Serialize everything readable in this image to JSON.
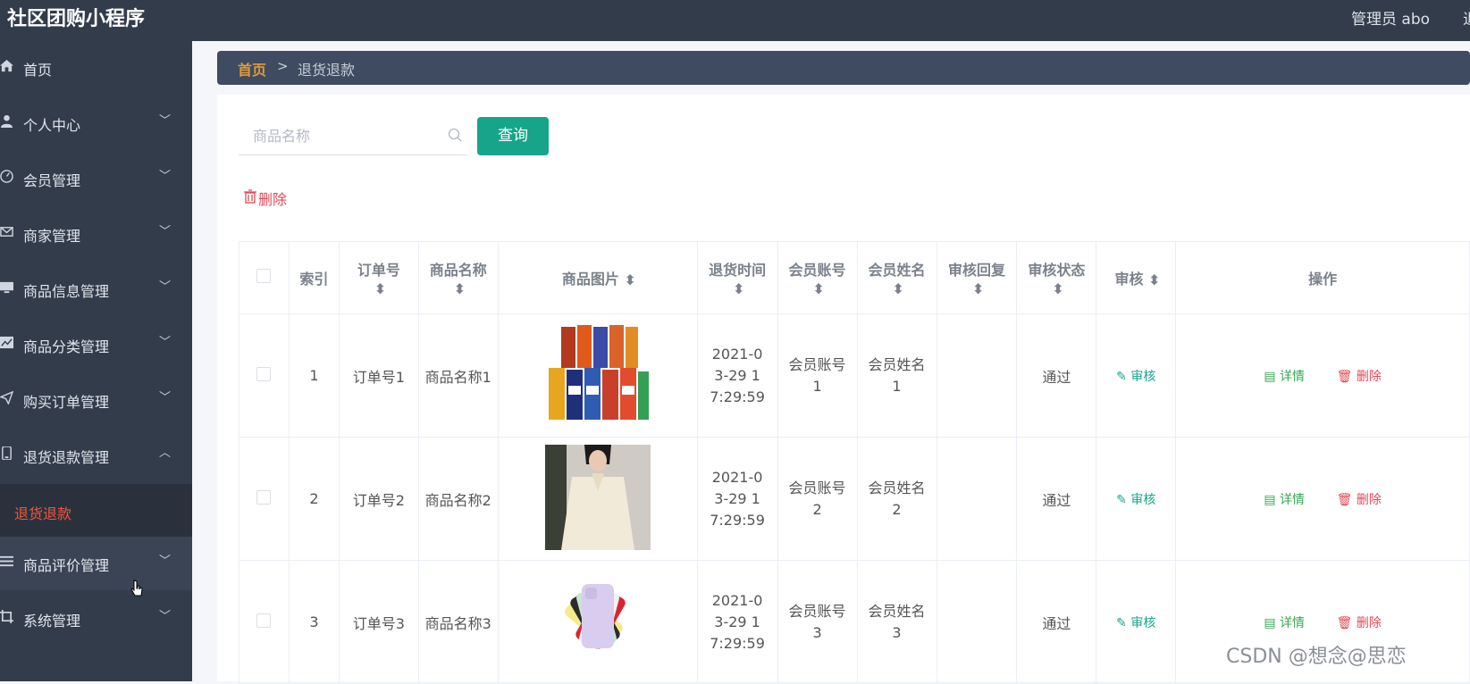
{
  "app": {
    "title": "社区团购小程序",
    "admin": "管理员 abo",
    "logout": "退"
  },
  "sidebar": {
    "items": [
      {
        "label": "首页",
        "icon": "home-icon",
        "has_chevron": false
      },
      {
        "label": "个人中心",
        "icon": "user-icon",
        "has_chevron": true
      },
      {
        "label": "会员管理",
        "icon": "dashboard-icon",
        "has_chevron": true
      },
      {
        "label": "商家管理",
        "icon": "mail-icon",
        "has_chevron": true
      },
      {
        "label": "商品信息管理",
        "icon": "monitor-icon",
        "has_chevron": true
      },
      {
        "label": "商品分类管理",
        "icon": "chart-icon",
        "has_chevron": true
      },
      {
        "label": "购买订单管理",
        "icon": "send-icon",
        "has_chevron": true
      },
      {
        "label": "退货退款管理",
        "icon": "phone-icon",
        "has_chevron": true,
        "expanded": true
      },
      {
        "label": "商品评价管理",
        "icon": "list-icon",
        "has_chevron": true
      },
      {
        "label": "系统管理",
        "icon": "crop-icon",
        "has_chevron": true
      }
    ],
    "submenu_active": "退货退款"
  },
  "breadcrumb": {
    "home": "首页",
    "separator": ">",
    "current": "退货退款"
  },
  "search": {
    "placeholder": "商品名称",
    "button": "查询"
  },
  "toolbar": {
    "delete_label": "删除"
  },
  "table": {
    "headers": [
      "索引",
      "订单号",
      "商品名称",
      "商品图片",
      "退货时间",
      "会员账号",
      "会员姓名",
      "审核回复",
      "审核状态",
      "审核",
      "操作"
    ],
    "rows": [
      {
        "index": "1",
        "order": "订单号1",
        "name": "商品名称1",
        "image": "snack-packs",
        "time": "2021-03-29 17:29:59",
        "account": "会员账号1",
        "member": "会员姓名1",
        "reply": "",
        "status": "通过",
        "audit": "审核",
        "detail": "详情",
        "delete": "删除"
      },
      {
        "index": "2",
        "order": "订单号2",
        "name": "商品名称2",
        "image": "white-blouse",
        "time": "2021-03-29 17:29:59",
        "account": "会员账号2",
        "member": "会员姓名2",
        "reply": "",
        "status": "通过",
        "audit": "审核",
        "detail": "详情",
        "delete": "删除"
      },
      {
        "index": "3",
        "order": "订单号3",
        "name": "商品名称3",
        "image": "phone-fan",
        "time": "2021-03-29 17:29:59",
        "account": "会员账号3",
        "member": "会员姓名3",
        "reply": "",
        "status": "通过",
        "audit": "审核",
        "detail": "详情",
        "delete": "删除"
      }
    ]
  },
  "watermark": "CSDN @想念@思恋",
  "colors": {
    "topbar": "#333c4b",
    "accent": "#17a58a",
    "danger": "#e04a55",
    "active_menu": "#f3553d",
    "breadcrumb_home": "#e09a3a"
  }
}
